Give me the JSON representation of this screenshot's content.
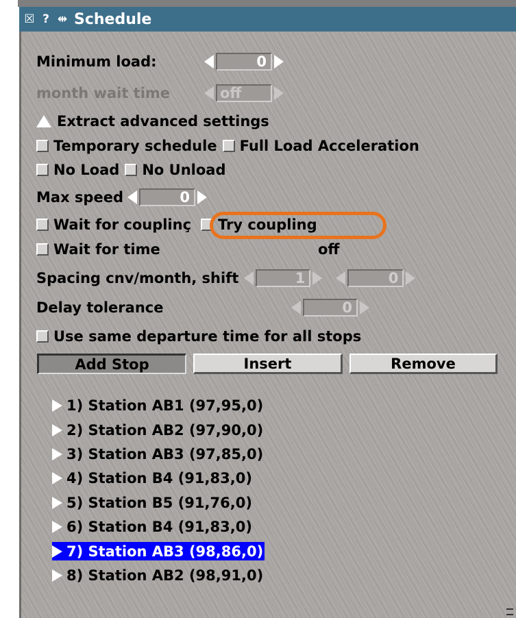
{
  "window": {
    "title": "Schedule"
  },
  "settings": {
    "minimum_load": {
      "label": "Minimum load:",
      "value": "0"
    },
    "month_wait_time": {
      "label": "month wait time",
      "value": "off"
    },
    "extract_advanced": "Extract advanced settings",
    "temporary_schedule": "Temporary schedule",
    "full_load_acceleration": "Full Load Acceleration",
    "no_load": "No Load",
    "no_unload": "No Unload",
    "max_speed": {
      "label": "Max speed",
      "value": "0"
    },
    "wait_for_coupling": "Wait for couplinç",
    "try_coupling": "Try coupling",
    "wait_for_time": {
      "label": "Wait for time",
      "value": "off"
    },
    "spacing": {
      "label": "Spacing cnv/month, shift",
      "value1": "1",
      "value2": "0"
    },
    "delay_tolerance": {
      "label": "Delay tolerance",
      "value": "0"
    },
    "same_departure": "Use same departure time for all stops"
  },
  "buttons": {
    "add_stop": "Add Stop",
    "insert": "Insert",
    "remove": "Remove"
  },
  "stops": [
    "1) Station AB1 (97,95,0)",
    "2) Station AB2 (97,90,0)",
    "3) Station AB3 (97,85,0)",
    "4) Station B4 (91,83,0)",
    "5) Station B5 (91,76,0)",
    "6) Station B4 (91,83,0)",
    "7) Station AB3 (98,86,0)",
    "8) Station AB2 (98,91,0)"
  ],
  "selected_stop_index": 6,
  "colors": {
    "titlebar": "#3e6f8a",
    "selection": "#0000ff",
    "highlight_ring": "#e8731e"
  }
}
